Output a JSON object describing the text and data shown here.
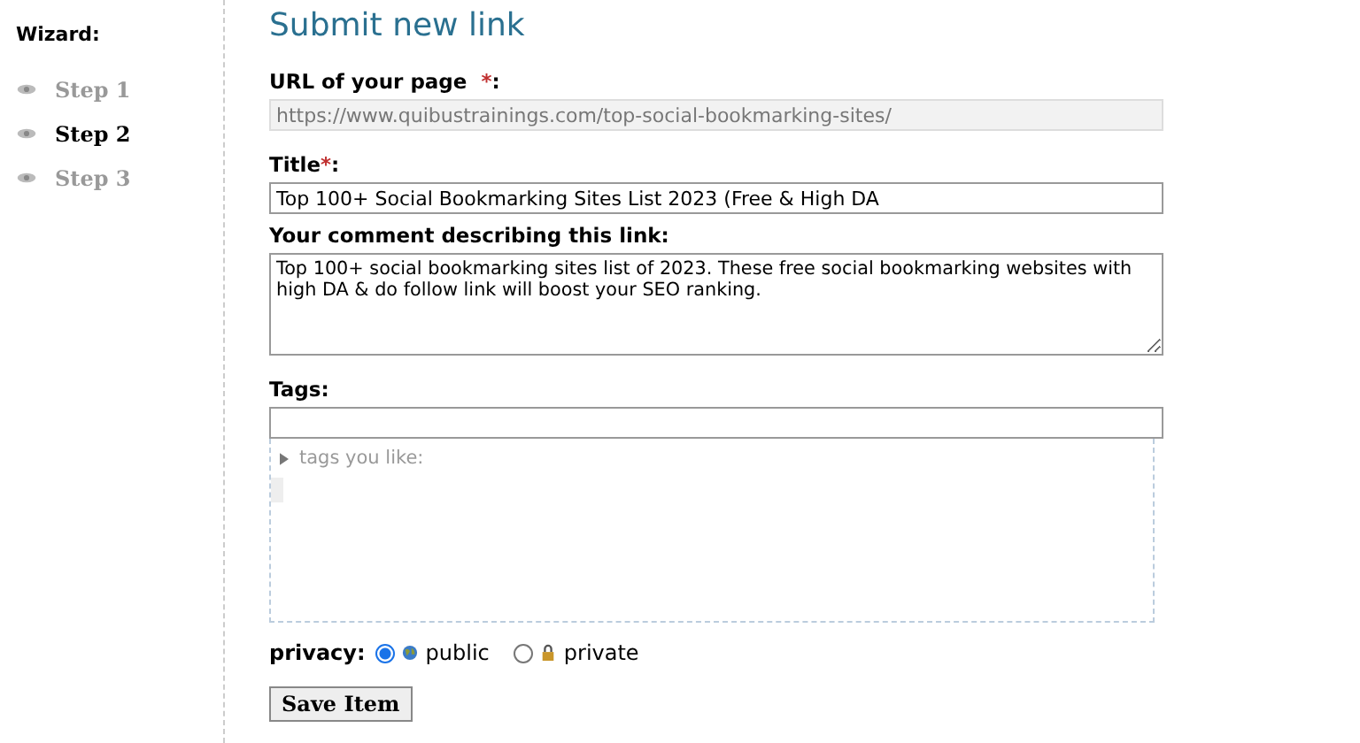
{
  "wizard": {
    "title": "Wizard:",
    "steps": [
      {
        "label": "Step 1",
        "selected": false
      },
      {
        "label": "Step 2",
        "selected": true
      },
      {
        "label": "Step 3",
        "selected": false
      }
    ]
  },
  "heading": "Submit new link",
  "url_field": {
    "label": "URL of your page",
    "required_mark": "*",
    "label_end": ":",
    "value": "https://www.quibustrainings.com/top-social-bookmarking-sites/",
    "disabled": true
  },
  "title_field": {
    "label": "Title",
    "required_mark": "*",
    "label_end": ":",
    "value": "Top 100+ Social Bookmarking Sites List 2023 (Free & High DA"
  },
  "comment_field": {
    "label": "Your comment describing this link:",
    "value": "Top 100+ social bookmarking sites list of 2023. These free social bookmarking websites with high DA & do follow link will boost your SEO ranking."
  },
  "tags_field": {
    "label": "Tags:",
    "suggestions_label": "tags you like:",
    "expanded": false
  },
  "privacy": {
    "label": "privacy:",
    "options": [
      {
        "label": "public",
        "kind": "public",
        "selected": true
      },
      {
        "label": "private",
        "kind": "private",
        "selected": false
      }
    ]
  },
  "submit_button": "Save Item"
}
